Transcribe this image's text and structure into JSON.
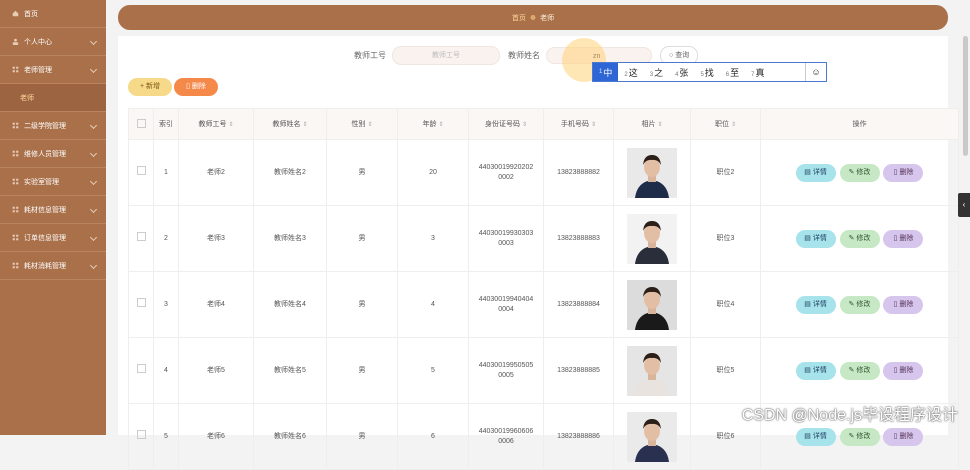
{
  "sidebar": {
    "items": [
      {
        "label": "首页",
        "icon": "home-icon"
      },
      {
        "label": "个人中心",
        "icon": "user-icon"
      },
      {
        "label": "老师管理",
        "icon": "grid-icon"
      },
      {
        "label": "二级学院管理",
        "icon": "grid-icon"
      },
      {
        "label": "维修人员管理",
        "icon": "grid-icon"
      },
      {
        "label": "实验室管理",
        "icon": "grid-icon"
      },
      {
        "label": "耗材信息管理",
        "icon": "grid-icon"
      },
      {
        "label": "订单信息管理",
        "icon": "grid-icon"
      },
      {
        "label": "耗材消耗管理",
        "icon": "grid-icon"
      }
    ],
    "sub_item": "老师"
  },
  "breadcrumb": {
    "home": "首页",
    "separator": "☸",
    "current": "老师"
  },
  "search": {
    "teacher_no_label": "教师工号",
    "teacher_no_placeholder": "教师工号",
    "teacher_name_label": "教师姓名",
    "teacher_name_value": "zn",
    "query_label": "查询"
  },
  "ime": {
    "candidates": [
      {
        "n": "1",
        "t": "中"
      },
      {
        "n": "2",
        "t": "这"
      },
      {
        "n": "3",
        "t": "之"
      },
      {
        "n": "4",
        "t": "张"
      },
      {
        "n": "5",
        "t": "找"
      },
      {
        "n": "6",
        "t": "至"
      },
      {
        "n": "7",
        "t": "真"
      }
    ],
    "emoji": "☺"
  },
  "toolbar": {
    "add_label": "+ 新增",
    "delete_label": "删除"
  },
  "table": {
    "headers": [
      "索引",
      "教师工号",
      "教师姓名",
      "性别",
      "年龄",
      "身份证号码",
      "手机号码",
      "相片",
      "职位",
      "操作"
    ],
    "rows": [
      {
        "idx": "1",
        "no": "老师2",
        "name": "教师姓名2",
        "sex": "男",
        "age": "20",
        "id1": "44030019920202",
        "id2": "0002",
        "phone": "13823888882",
        "pos": "职位2"
      },
      {
        "idx": "2",
        "no": "老师3",
        "name": "教师姓名3",
        "sex": "男",
        "age": "3",
        "id1": "44030019930303",
        "id2": "0003",
        "phone": "13823888883",
        "pos": "职位3"
      },
      {
        "idx": "3",
        "no": "老师4",
        "name": "教师姓名4",
        "sex": "男",
        "age": "4",
        "id1": "44030019940404",
        "id2": "0004",
        "phone": "13823888884",
        "pos": "职位4"
      },
      {
        "idx": "4",
        "no": "老师5",
        "name": "教师姓名5",
        "sex": "男",
        "age": "5",
        "id1": "44030019950505",
        "id2": "0005",
        "phone": "13823888885",
        "pos": "职位5"
      },
      {
        "idx": "5",
        "no": "老师6",
        "name": "教师姓名6",
        "sex": "男",
        "age": "6",
        "id1": "44030019960606",
        "id2": "0006",
        "phone": "13823888886",
        "pos": "职位6"
      }
    ],
    "ops": {
      "detail": "详情",
      "edit": "修改",
      "remove": "删除"
    }
  },
  "watermark": "CSDN @Node.js毕设程序设计",
  "colors": {
    "sidebar": "#a9704a",
    "accent": "#ffd89b",
    "add": "#f7d98a",
    "delete": "#f5894a"
  }
}
